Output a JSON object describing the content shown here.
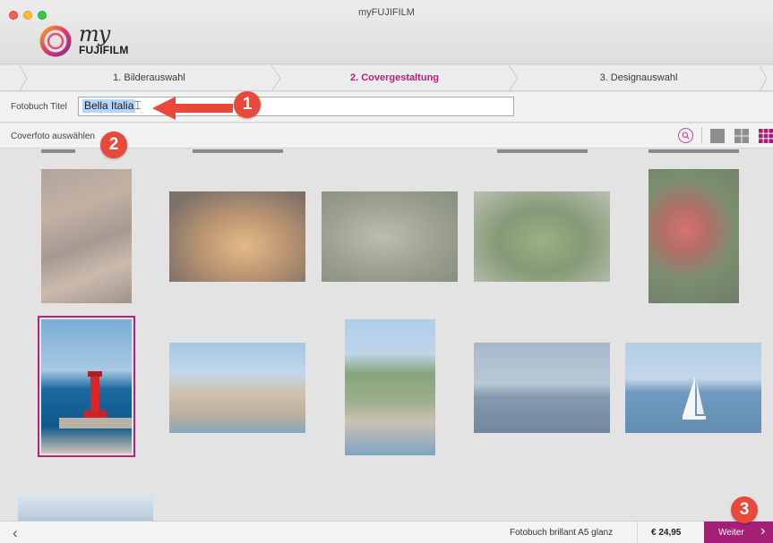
{
  "window": {
    "title": "myFUJIFILM"
  },
  "logo": {
    "script": "my",
    "brand": "FUJIFILM"
  },
  "steps": [
    {
      "label": "1. Bilderauswahl"
    },
    {
      "label": "2. Covergestaltung"
    },
    {
      "label": "3. Designauswahl"
    }
  ],
  "title_row": {
    "label": "Fotobuch Titel",
    "value": "Bella Italia"
  },
  "tool_row": {
    "label": "Coverfoto auswählen"
  },
  "footer": {
    "product": "Fotobuch brillant A5 glanz",
    "price": "€ 24,95",
    "next_label": "Weiter"
  },
  "annotations": {
    "badge1": "1",
    "badge2": "2",
    "badge3": "3"
  },
  "colors": {
    "accent": "#b4237c",
    "next_button": "#a51f77",
    "badge": "#e8493b",
    "selection": "#b5d5fd"
  },
  "icons": {
    "search": "search-icon",
    "view_large": "single-view-icon",
    "view_medium": "medium-grid-icon",
    "view_small": "small-grid-icon"
  }
}
